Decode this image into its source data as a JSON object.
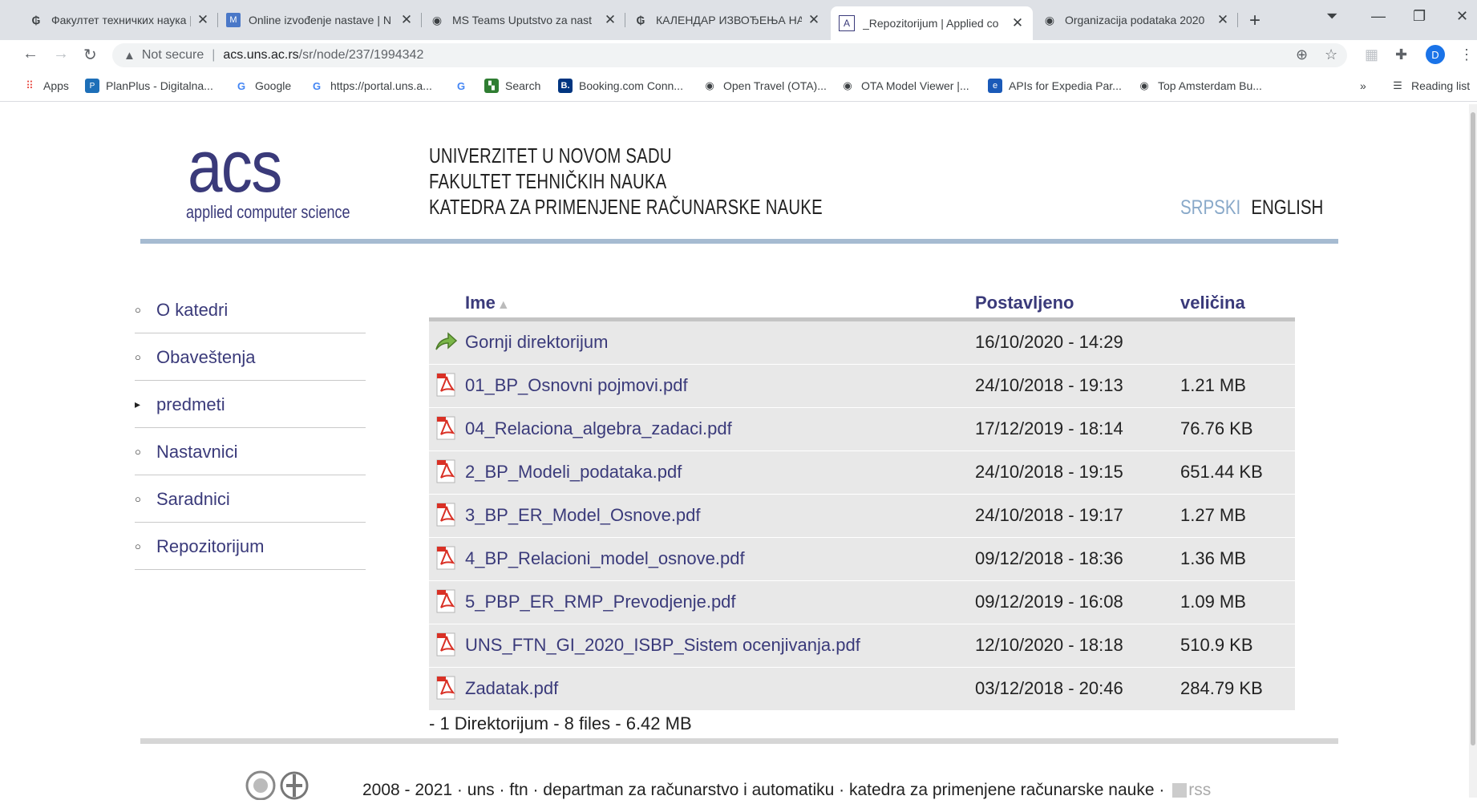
{
  "browser": {
    "tabs": [
      {
        "title": "Факултет техничких наука |",
        "icon": "ftn-logo-icon"
      },
      {
        "title": "Online izvođenje nastave | N",
        "icon": "moodle-icon"
      },
      {
        "title": "MS Teams Uputstvo za nast",
        "icon": "globe-icon"
      },
      {
        "title": "КАЛЕНДАР ИЗВОЂЕЊА НА",
        "icon": "ftn-logo-icon"
      },
      {
        "title": "_Repozitorijum | Applied co",
        "icon": "acs-favicon-icon"
      },
      {
        "title": "Organizacija podataka 2020",
        "icon": "globe-icon"
      }
    ],
    "url": {
      "security": "Not secure",
      "host": "acs.uns.ac.rs",
      "path": "/sr/node/237/1994342"
    },
    "profile_initial": "D",
    "bookmarks": [
      {
        "label": "Apps"
      },
      {
        "label": "PlanPlus - Digitalna..."
      },
      {
        "label": "Google"
      },
      {
        "label": "https://portal.uns.a..."
      },
      {
        "label": ""
      },
      {
        "label": "Search"
      },
      {
        "label": "Booking.com Conn..."
      },
      {
        "label": "Open Travel (OTA)..."
      },
      {
        "label": "OTA Model Viewer |..."
      },
      {
        "label": "APIs for Expedia Par..."
      },
      {
        "label": "Top Amsterdam Bu..."
      }
    ],
    "overflow": "»",
    "reading_list": "Reading list"
  },
  "header": {
    "logo_text": "acs",
    "logo_sub": "applied computer science",
    "university": [
      "UNIVERZITET U NOVOM SADU",
      "FAKULTET TEHNIČKIH NAUKA",
      "KATEDRA ZA PRIMENJENE RAČUNARSKE NAUKE"
    ],
    "lang_sr": "SRPSKI",
    "lang_en": "ENGLISH"
  },
  "menu": [
    {
      "label": "O katedri",
      "marker": "○"
    },
    {
      "label": "Obaveštenja",
      "marker": "○"
    },
    {
      "label": "predmeti",
      "marker": "▸"
    },
    {
      "label": "Nastavnici",
      "marker": "○"
    },
    {
      "label": "Saradnici",
      "marker": "○"
    },
    {
      "label": "Repozitorijum",
      "marker": "○"
    }
  ],
  "table": {
    "columns": {
      "name": "Ime",
      "date": "Postavljeno",
      "size": "veličina"
    },
    "rows": [
      {
        "name": "Gornji direktorijum",
        "date": "16/10/2020 - 14:29",
        "size": "",
        "icon": "folder-up-icon"
      },
      {
        "name": "01_BP_Osnovni pojmovi.pdf",
        "date": "24/10/2018 - 19:13",
        "size": "1.21 MB",
        "icon": "pdf-icon"
      },
      {
        "name": "04_Relaciona_algebra_zadaci.pdf",
        "date": "17/12/2019 - 18:14",
        "size": "76.76 KB",
        "icon": "pdf-icon"
      },
      {
        "name": "2_BP_Modeli_podataka.pdf",
        "date": "24/10/2018 - 19:15",
        "size": "651.44 KB",
        "icon": "pdf-icon"
      },
      {
        "name": "3_BP_ER_Model_Osnove.pdf",
        "date": "24/10/2018 - 19:17",
        "size": "1.27 MB",
        "icon": "pdf-icon"
      },
      {
        "name": "4_BP_Relacioni_model_osnove.pdf",
        "date": "09/12/2018 - 18:36",
        "size": "1.36 MB",
        "icon": "pdf-icon"
      },
      {
        "name": "5_PBP_ER_RMP_Prevodjenje.pdf",
        "date": "09/12/2019 - 16:08",
        "size": "1.09 MB",
        "icon": "pdf-icon"
      },
      {
        "name": "UNS_FTN_GI_2020_ISBP_Sistem ocenjivanja.pdf",
        "date": "12/10/2020 - 18:18",
        "size": "510.9 KB",
        "icon": "pdf-icon"
      },
      {
        "name": "Zadatak.pdf",
        "date": "03/12/2018 - 20:46",
        "size": "284.79 KB",
        "icon": "pdf-icon"
      }
    ],
    "summary": "- 1 Direktorijum - 8 files - 6.42 MB"
  },
  "footer": {
    "text": "2008 - 2021 · uns · ftn · departman za računarstvo i automatiku · katedra za primenjene računarske nauke ·",
    "rss": "rss"
  },
  "colors": {
    "link": "#3a3a7a",
    "accent_line": "#a6bbd1",
    "row_bg": "#e8e8e8"
  }
}
